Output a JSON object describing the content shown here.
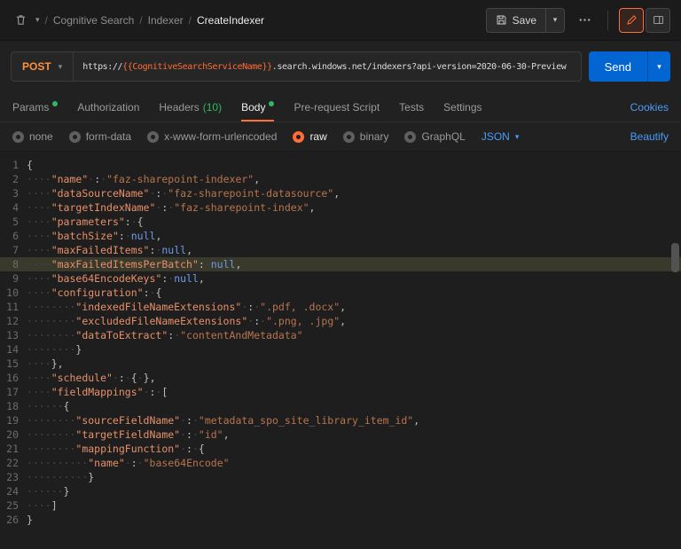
{
  "header": {
    "breadcrumb": {
      "items": [
        "Cognitive Search",
        "Indexer",
        "CreateIndexer"
      ]
    },
    "save_label": "Save"
  },
  "request": {
    "method": "POST",
    "url": {
      "prefix": "https://",
      "variable": "{{CognitiveSearchServiceName}}",
      "suffix": ".search.windows.net/indexers?api-version=2020-06-30-Preview"
    },
    "send_label": "Send"
  },
  "tabs": [
    {
      "label": "Params",
      "dot": true,
      "active": false
    },
    {
      "label": "Authorization",
      "dot": false,
      "active": false
    },
    {
      "label": "Headers",
      "count": "(10)",
      "dot": false,
      "active": false
    },
    {
      "label": "Body",
      "dot": true,
      "active": true
    },
    {
      "label": "Pre-request Script",
      "dot": false,
      "active": false
    },
    {
      "label": "Tests",
      "dot": false,
      "active": false
    },
    {
      "label": "Settings",
      "dot": false,
      "active": false
    }
  ],
  "cookies_label": "Cookies",
  "body_bar": {
    "options": [
      {
        "label": "none",
        "selected": false
      },
      {
        "label": "form-data",
        "selected": false
      },
      {
        "label": "x-www-form-urlencoded",
        "selected": false
      },
      {
        "label": "raw",
        "selected": true
      },
      {
        "label": "binary",
        "selected": false
      },
      {
        "label": "GraphQL",
        "selected": false
      }
    ],
    "format": "JSON",
    "beautify_label": "Beautify"
  },
  "colors": {
    "accent_orange": "#ff6c37",
    "green": "#2db964",
    "link_blue": "#4a9cf8",
    "send_blue": "#0265d2",
    "method_post": "#ff913e",
    "token_key": "#e8906b",
    "token_string": "#b8744f",
    "token_null": "#6c9ced",
    "highlight_row": "#39392c"
  },
  "editor": {
    "highlight_line": 8,
    "lines": [
      {
        "n": 1,
        "t": [
          [
            "p",
            "{"
          ]
        ]
      },
      {
        "n": 2,
        "t": [
          [
            "w",
            "    "
          ],
          [
            "k",
            "\"name\""
          ],
          [
            "w",
            " "
          ],
          [
            "p",
            ":"
          ],
          [
            "w",
            " "
          ],
          [
            "s",
            "\"faz-sharepoint-indexer\""
          ],
          [
            "p",
            ","
          ]
        ]
      },
      {
        "n": 3,
        "t": [
          [
            "w",
            "    "
          ],
          [
            "k",
            "\"dataSourceName\""
          ],
          [
            "w",
            " "
          ],
          [
            "p",
            ":"
          ],
          [
            "w",
            " "
          ],
          [
            "s",
            "\"faz-sharepoint-datasource\""
          ],
          [
            "p",
            ","
          ]
        ]
      },
      {
        "n": 4,
        "t": [
          [
            "w",
            "    "
          ],
          [
            "k",
            "\"targetIndexName\""
          ],
          [
            "w",
            " "
          ],
          [
            "p",
            ":"
          ],
          [
            "w",
            " "
          ],
          [
            "s",
            "\"faz-sharepoint-index\""
          ],
          [
            "p",
            ","
          ]
        ]
      },
      {
        "n": 5,
        "t": [
          [
            "w",
            "    "
          ],
          [
            "k",
            "\"parameters\""
          ],
          [
            "p",
            ":"
          ],
          [
            "w",
            " "
          ],
          [
            "p",
            "{"
          ]
        ]
      },
      {
        "n": 6,
        "t": [
          [
            "w",
            "    "
          ],
          [
            "k",
            "\"batchSize\""
          ],
          [
            "p",
            ":"
          ],
          [
            "w",
            " "
          ],
          [
            "n",
            "null"
          ],
          [
            "p",
            ","
          ]
        ]
      },
      {
        "n": 7,
        "t": [
          [
            "w",
            "    "
          ],
          [
            "k",
            "\"maxFailedItems\""
          ],
          [
            "p",
            ":"
          ],
          [
            "w",
            " "
          ],
          [
            "n",
            "null"
          ],
          [
            "p",
            ","
          ]
        ]
      },
      {
        "n": 8,
        "t": [
          [
            "w",
            "    "
          ],
          [
            "k",
            "\"maxFailedItemsPerBatch\""
          ],
          [
            "p",
            ":"
          ],
          [
            "w",
            " "
          ],
          [
            "n",
            "null"
          ],
          [
            "p",
            ","
          ]
        ]
      },
      {
        "n": 9,
        "t": [
          [
            "w",
            "    "
          ],
          [
            "k",
            "\"base64EncodeKeys\""
          ],
          [
            "p",
            ":"
          ],
          [
            "w",
            " "
          ],
          [
            "n",
            "null"
          ],
          [
            "p",
            ","
          ]
        ]
      },
      {
        "n": 10,
        "t": [
          [
            "w",
            "    "
          ],
          [
            "k",
            "\"configuration\""
          ],
          [
            "p",
            ":"
          ],
          [
            "w",
            " "
          ],
          [
            "p",
            "{"
          ]
        ]
      },
      {
        "n": 11,
        "t": [
          [
            "w",
            "        "
          ],
          [
            "k",
            "\"indexedFileNameExtensions\""
          ],
          [
            "w",
            " "
          ],
          [
            "p",
            ":"
          ],
          [
            "w",
            " "
          ],
          [
            "s",
            "\".pdf, .docx\""
          ],
          [
            "p",
            ","
          ]
        ]
      },
      {
        "n": 12,
        "t": [
          [
            "w",
            "        "
          ],
          [
            "k",
            "\"excludedFileNameExtensions\""
          ],
          [
            "w",
            " "
          ],
          [
            "p",
            ":"
          ],
          [
            "w",
            " "
          ],
          [
            "s",
            "\".png, .jpg\""
          ],
          [
            "p",
            ","
          ]
        ]
      },
      {
        "n": 13,
        "t": [
          [
            "w",
            "        "
          ],
          [
            "k",
            "\"dataToExtract\""
          ],
          [
            "p",
            ":"
          ],
          [
            "w",
            " "
          ],
          [
            "s",
            "\"contentAndMetadata\""
          ]
        ]
      },
      {
        "n": 14,
        "t": [
          [
            "w",
            "        "
          ],
          [
            "p",
            "}"
          ]
        ]
      },
      {
        "n": 15,
        "t": [
          [
            "w",
            "    "
          ],
          [
            "p",
            "},"
          ]
        ]
      },
      {
        "n": 16,
        "t": [
          [
            "w",
            "    "
          ],
          [
            "k",
            "\"schedule\""
          ],
          [
            "w",
            " "
          ],
          [
            "p",
            ":"
          ],
          [
            "w",
            " "
          ],
          [
            "p",
            "{"
          ],
          [
            "w",
            " "
          ],
          [
            "p",
            "},"
          ]
        ]
      },
      {
        "n": 17,
        "t": [
          [
            "w",
            "    "
          ],
          [
            "k",
            "\"fieldMappings\""
          ],
          [
            "w",
            " "
          ],
          [
            "p",
            ":"
          ],
          [
            "w",
            " "
          ],
          [
            "p",
            "["
          ]
        ]
      },
      {
        "n": 18,
        "t": [
          [
            "w",
            "      "
          ],
          [
            "p",
            "{"
          ]
        ]
      },
      {
        "n": 19,
        "t": [
          [
            "w",
            "        "
          ],
          [
            "k",
            "\"sourceFieldName\""
          ],
          [
            "w",
            " "
          ],
          [
            "p",
            ":"
          ],
          [
            "w",
            " "
          ],
          [
            "s",
            "\"metadata_spo_site_library_item_id\""
          ],
          [
            "p",
            ","
          ]
        ]
      },
      {
        "n": 20,
        "t": [
          [
            "w",
            "        "
          ],
          [
            "k",
            "\"targetFieldName\""
          ],
          [
            "w",
            " "
          ],
          [
            "p",
            ":"
          ],
          [
            "w",
            " "
          ],
          [
            "s",
            "\"id\""
          ],
          [
            "p",
            ","
          ]
        ]
      },
      {
        "n": 21,
        "t": [
          [
            "w",
            "        "
          ],
          [
            "k",
            "\"mappingFunction\""
          ],
          [
            "w",
            " "
          ],
          [
            "p",
            ":"
          ],
          [
            "w",
            " "
          ],
          [
            "p",
            "{"
          ]
        ]
      },
      {
        "n": 22,
        "t": [
          [
            "w",
            "          "
          ],
          [
            "k",
            "\"name\""
          ],
          [
            "w",
            " "
          ],
          [
            "p",
            ":"
          ],
          [
            "w",
            " "
          ],
          [
            "s",
            "\"base64Encode\""
          ]
        ]
      },
      {
        "n": 23,
        "t": [
          [
            "w",
            "          "
          ],
          [
            "p",
            "}"
          ]
        ]
      },
      {
        "n": 24,
        "t": [
          [
            "w",
            "      "
          ],
          [
            "p",
            "}"
          ]
        ]
      },
      {
        "n": 25,
        "t": [
          [
            "w",
            "    "
          ],
          [
            "p",
            "]"
          ]
        ]
      },
      {
        "n": 26,
        "t": [
          [
            "p",
            "}"
          ]
        ]
      }
    ]
  }
}
